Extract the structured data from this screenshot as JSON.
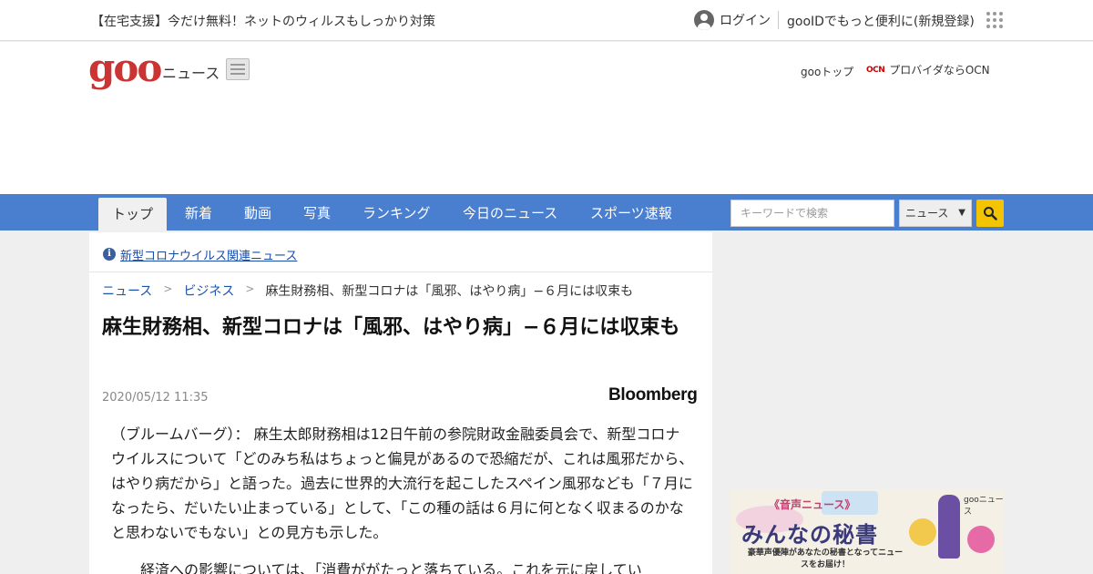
{
  "utilbar": {
    "promo": "【在宅支援】今だけ無料！ネットのウィルスもしっかり対策",
    "login": "ログイン",
    "register": "gooIDでもっと便利に(新規登録)"
  },
  "header": {
    "logo": "goo",
    "section": "ニュース",
    "gootop": "gooトップ",
    "ocn_logo": "OCN",
    "ocn_text": "プロバイダならOCN"
  },
  "nav": {
    "tabs": [
      "トップ",
      "新着",
      "動画",
      "写真",
      "ランキング",
      "今日のニュース",
      "スポーツ速報"
    ],
    "search_placeholder": "キーワードで検索",
    "search_scope": "ニュース",
    "search_scope_caret": "▼"
  },
  "article": {
    "covid_link": "新型コロナウイルス関連ニュース",
    "breadcrumb": {
      "home": "ニュース",
      "category": "ビジネス",
      "current": "麻生財務相、新型コロナは「風邪、はやり病」−６月には収束も",
      "separator": ">"
    },
    "title": "麻生財務相、新型コロナは「風邪、はやり病」−６月には収束も",
    "date": "2020/05/12 11:35",
    "source": "Bloomberg",
    "paragraphs": [
      "（ブルームバーグ）： 麻生太郎財務相は12日午前の参院財政金融委員会で、新型コロナウイルスについて「どのみち私はちょっと偏見があるので恐縮だが、これは風邪だから、はやり病だから」と語った。過去に世界的大流行を起こしたスペイン風邪なども「７月になったら、だいたい止まっている」として、「この種の話は６月に何となく収まるのかなと思わないでもない」との見方も示した。",
      "経済への影響については、「消費ががたっと落ちている。これを元に戻してい"
    ]
  },
  "ad": {
    "top_label": "《音声ニュース》",
    "brand": "gooニュース",
    "title": "みんなの秘書",
    "subtitle": "豪華声優陣があなたの秘書となってニュースをお届け！"
  }
}
